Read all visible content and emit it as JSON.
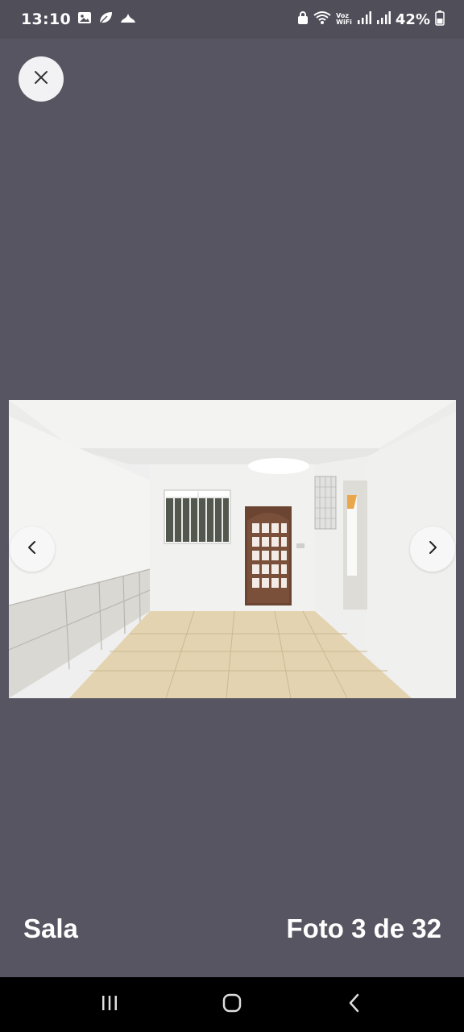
{
  "status_bar": {
    "time": "13:10",
    "left_icons": [
      "image-icon",
      "leaf-icon",
      "cloud-icon"
    ],
    "right_icons": [
      "lock-icon",
      "wifi-calling-icon",
      "signal-icon",
      "signal-icon",
      "battery-icon"
    ],
    "voz_top": "Voz",
    "voz_bottom": "WiFi",
    "battery": "42%"
  },
  "viewer": {
    "close_icon": "close-icon",
    "prev_icon": "chevron-left-icon",
    "next_icon": "chevron-right-icon",
    "room_label": "Sala",
    "counter": "Foto 3 de 32",
    "current_photo": 3,
    "total_photos": 32
  },
  "navigation_bar": {
    "keys": [
      "recents-icon",
      "home-icon",
      "back-icon"
    ]
  },
  "colors": {
    "background": "#565561",
    "status_bar": "#4f4e59",
    "button_bg": "#f2f2f4",
    "text": "#ffffff"
  }
}
